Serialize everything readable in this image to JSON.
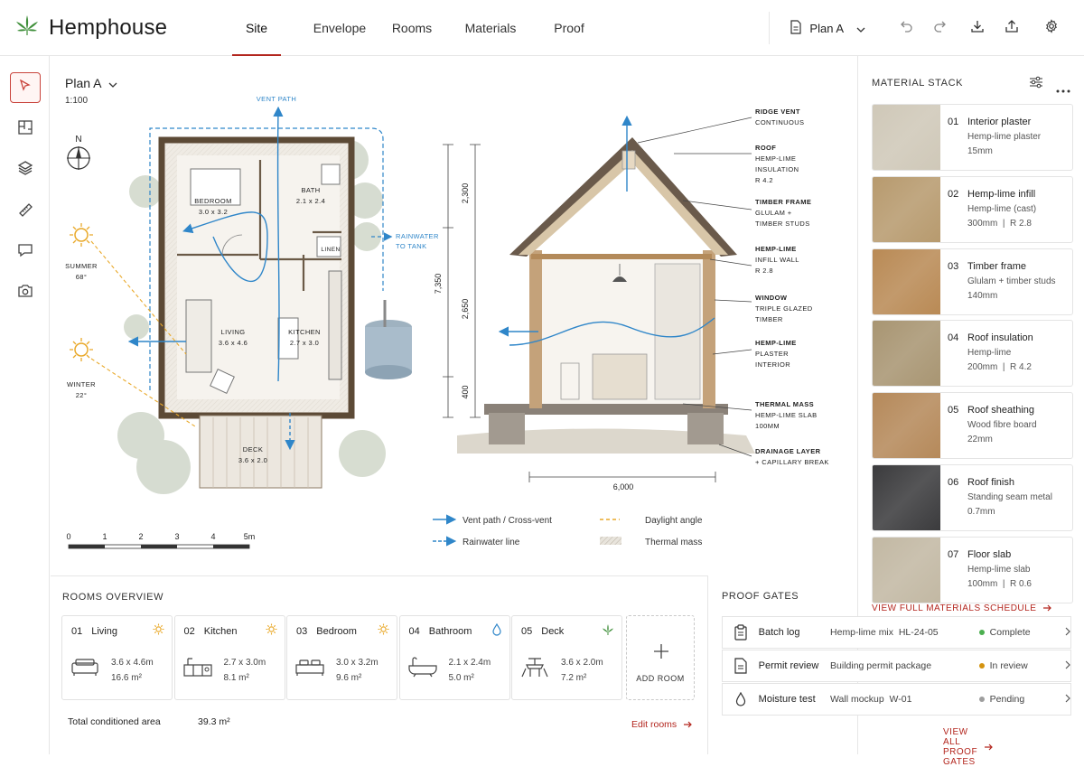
{
  "app": {
    "title": "Hemphouse"
  },
  "tabs": [
    {
      "label": "Site",
      "active": true
    },
    {
      "label": "Envelope",
      "active": false
    },
    {
      "label": "Rooms",
      "active": false
    },
    {
      "label": "Materials",
      "active": false
    },
    {
      "label": "Proof",
      "active": false
    }
  ],
  "toolbar": {
    "plan_selector": "Plan A"
  },
  "canvas": {
    "plan_title": "Plan A",
    "scale": "1:100",
    "north": "N",
    "plan_labels": {
      "vent_path": "VENT PATH",
      "rainwater": "RAINWATER",
      "rainwater2": "TO TANK",
      "summer": "SUMMER",
      "summer_angle": "68°",
      "winter": "WINTER",
      "winter_angle": "22°",
      "bedroom": "BEDROOM",
      "bedroom_dim": "3.0 x 3.2",
      "bath": "BATH",
      "bath_dim": "2.1 x 2.4",
      "linen": "LINEN",
      "living": "LIVING",
      "living_dim": "3.6 x 4.6",
      "kitchen": "KITCHEN",
      "kitchen_dim": "2.7 x 3.0",
      "deck": "DECK",
      "deck_dim": "3.6 x 2.0"
    },
    "scale_bar": [
      "0",
      "1",
      "2",
      "3",
      "4",
      "5m"
    ],
    "section": {
      "dims_v": [
        "2,300",
        "7,350",
        "2,650",
        "400"
      ],
      "dim_h": "6,000",
      "callouts": [
        [
          "RIDGE VENT",
          "CONTINUOUS"
        ],
        [
          "ROOF",
          "HEMP-LIME",
          "INSULATION",
          "R 4.2"
        ],
        [
          "TIMBER FRAME",
          "GLULAM +",
          "TIMBER STUDS"
        ],
        [
          "HEMP-LIME",
          "INFILL WALL",
          "R 2.8"
        ],
        [
          "WINDOW",
          "TRIPLE GLAZED",
          "TIMBER"
        ],
        [
          "HEMP-LIME",
          "PLASTER",
          "INTERIOR"
        ],
        [
          "THERMAL MASS",
          "HEMP-LIME SLAB",
          "100MM"
        ],
        [
          "DRAINAGE LAYER",
          "+ CAPILLARY BREAK"
        ]
      ]
    },
    "legend": {
      "vent": "Vent path / Cross-vent",
      "daylight": "Daylight angle",
      "rain": "Rainwater line",
      "thermal": "Thermal mass"
    }
  },
  "materials": {
    "title": "MATERIAL STACK",
    "items": [
      {
        "num": "01",
        "name": "Interior plaster",
        "sub1": "Hemp-lime plaster",
        "sub2": "15mm",
        "swatch": "#cfc8b8"
      },
      {
        "num": "02",
        "name": "Hemp-lime infill",
        "sub1": "Hemp-lime (cast)",
        "sub2": "300mm  |  R 2.8",
        "swatch": "#b79a6e"
      },
      {
        "num": "03",
        "name": "Timber frame",
        "sub1": "Glulam + timber studs",
        "sub2": "140mm",
        "swatch": "#b98a55"
      },
      {
        "num": "04",
        "name": "Roof insulation",
        "sub1": "Hemp-lime",
        "sub2": "200mm  |  R 4.2",
        "swatch": "#a89572"
      },
      {
        "num": "05",
        "name": "Roof sheathing",
        "sub1": "Wood fibre board",
        "sub2": "22mm",
        "swatch": "#b5895a"
      },
      {
        "num": "06",
        "name": "Roof finish",
        "sub1": "Standing seam metal",
        "sub2": "0.7mm",
        "swatch": "#3b3b3d"
      },
      {
        "num": "07",
        "name": "Floor slab",
        "sub1": "Hemp-lime slab",
        "sub2": "100mm  |  R 0.6",
        "swatch": "#c2b8a3"
      }
    ],
    "link": "VIEW FULL MATERIALS SCHEDULE"
  },
  "rooms": {
    "title": "ROOMS OVERVIEW",
    "items": [
      {
        "num": "01",
        "name": "Living",
        "dim": "3.6 x 4.6m",
        "area": "16.6 m²",
        "badge": "sun"
      },
      {
        "num": "02",
        "name": "Kitchen",
        "dim": "2.7 x 3.0m",
        "area": "8.1 m²",
        "badge": "sun"
      },
      {
        "num": "03",
        "name": "Bedroom",
        "dim": "3.0 x 3.2m",
        "area": "9.6 m²",
        "badge": "sun"
      },
      {
        "num": "04",
        "name": "Bathroom",
        "dim": "2.1 x 2.4m",
        "area": "5.0 m²",
        "badge": "drop"
      },
      {
        "num": "05",
        "name": "Deck",
        "dim": "3.6 x 2.0m",
        "area": "7.2 m²",
        "badge": "leaf"
      }
    ],
    "add_label": "ADD ROOM",
    "total_label": "Total conditioned area",
    "total_value": "39.3 m²",
    "edit_link": "Edit rooms"
  },
  "proof": {
    "title": "PROOF GATES",
    "gates": [
      {
        "name": "Batch log",
        "desc": "Hemp-lime mix  HL-24-05",
        "status": "Complete",
        "color": "#4caf50"
      },
      {
        "name": "Permit review",
        "desc": "Building permit package",
        "status": "In review",
        "color": "#d4930f"
      },
      {
        "name": "Moisture test",
        "desc": "Wall mockup  W-01",
        "status": "Pending",
        "color": "#9e9e9e"
      }
    ],
    "link": "VIEW ALL PROOF GATES"
  },
  "colors": {
    "accent": "#b3261e",
    "vent": "#2f86c9",
    "daylight": "#e9a92a"
  }
}
